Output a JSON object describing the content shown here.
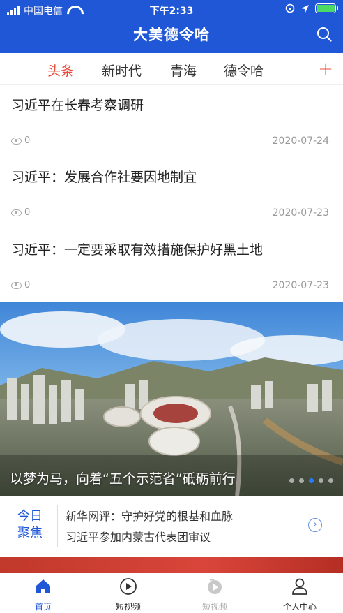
{
  "status_bar": {
    "carrier": "中国电信",
    "time": "下午2:33"
  },
  "header": {
    "title": "大美德令哈"
  },
  "tabs": [
    {
      "label": "头条",
      "active": true
    },
    {
      "label": "新时代",
      "active": false
    },
    {
      "label": "青海",
      "active": false
    },
    {
      "label": "德令哈",
      "active": false
    }
  ],
  "tabs_add_label": "+",
  "news": [
    {
      "title": "习近平在长春考察调研",
      "views": "0",
      "date": "2020-07-24"
    },
    {
      "title": "习近平：发展合作社要因地制宜",
      "views": "0",
      "date": "2020-07-23"
    },
    {
      "title": "习近平：一定要采取有效措施保护好黑土地",
      "views": "0",
      "date": "2020-07-23"
    }
  ],
  "banner": {
    "caption": "以梦为马，向着“五个示范省”砥砺前行",
    "dots": 5,
    "active_dot": 2
  },
  "today_focus": {
    "badge_line1": "今日",
    "badge_line2": "聚焦",
    "items": [
      "新华网评：守护好党的根基和血脉",
      "习近平参加内蒙古代表团审议"
    ]
  },
  "bottom_nav": [
    {
      "label": "首页",
      "icon": "home-icon",
      "active": true
    },
    {
      "label": "短视频",
      "icon": "play-circle-icon",
      "active": false
    },
    {
      "label": "短视频",
      "icon": "video-icon",
      "active": false
    },
    {
      "label": "个人中心",
      "icon": "user-icon",
      "active": false
    }
  ],
  "colors": {
    "brand_blue": "#1f57d6",
    "active_red": "#e74c3c",
    "nav_active": "#1f57d6"
  }
}
